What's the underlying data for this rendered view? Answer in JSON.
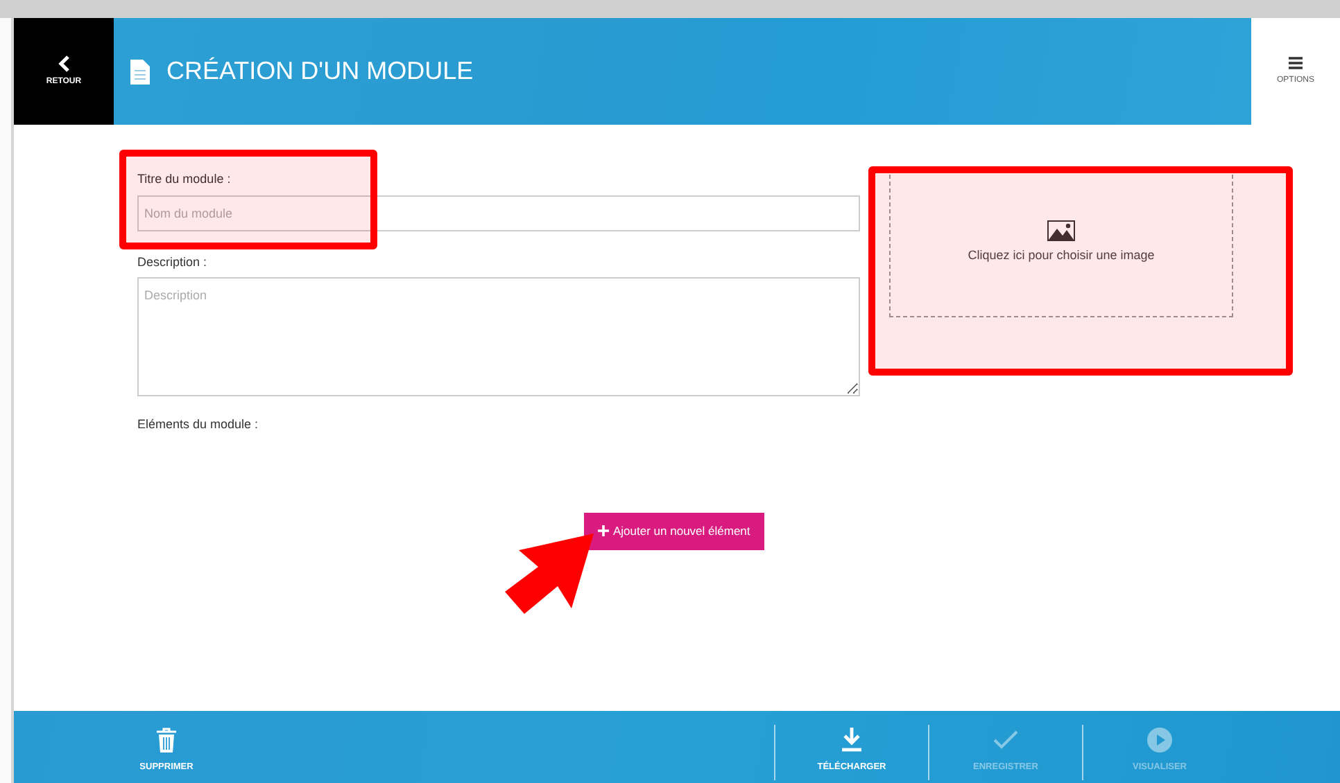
{
  "header": {
    "back_label": "RETOUR",
    "title": "CRÉATION D'UN MODULE",
    "options_label": "OPTIONS"
  },
  "form": {
    "fields": [
      {
        "kind": "input",
        "label": "Titre du module :",
        "placeholder": "Nom du module"
      },
      {
        "kind": "textarea",
        "label": "Description :",
        "placeholder": "Description"
      }
    ],
    "elements_label": "Eléments du module :",
    "add_button": "Ajouter un nouvel élément"
  },
  "image_picker": {
    "text": "Cliquez ici pour choisir une image"
  },
  "footer": {
    "actions": [
      {
        "kind": "delete",
        "label": "SUPPRIMER",
        "disabled": false
      },
      {
        "kind": "download",
        "label": "TÉLÉCHARGER",
        "disabled": false
      },
      {
        "kind": "save",
        "label": "ENREGISTRER",
        "disabled": true
      },
      {
        "kind": "preview",
        "label": "VISUALISER",
        "disabled": true
      }
    ]
  }
}
